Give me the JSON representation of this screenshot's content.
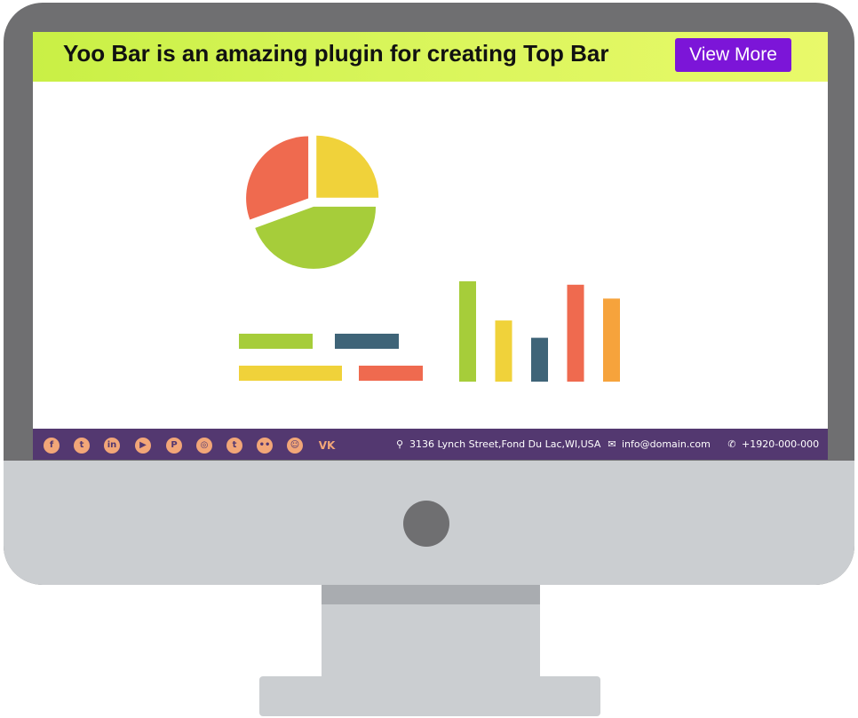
{
  "top_bar": {
    "text": "Yoo Bar is an amazing plugin for creating Top Bar",
    "button_label": "View More",
    "button_color": "#7c15d8",
    "background_color": "#d8f55a"
  },
  "illustration": {
    "pie_colors": [
      "#f0d23a",
      "#a6cd3a",
      "#ef6a4f"
    ],
    "legend_bar_colors": [
      "#a6cd3a",
      "#3f6478",
      "#f0d23a",
      "#ef6a4f"
    ],
    "column_colors": [
      "#a6cd3a",
      "#f0d23a",
      "#3f6478",
      "#ef6a4f",
      "#f6a33c"
    ],
    "column_levels": [
      0.87,
      0.53,
      0.38,
      0.84,
      0.72
    ]
  },
  "bottom_bar": {
    "background_color": "#533870",
    "social_icons": [
      {
        "name": "facebook-icon",
        "glyph": "f"
      },
      {
        "name": "twitter-icon",
        "glyph": "t"
      },
      {
        "name": "linkedin-icon",
        "glyph": "in"
      },
      {
        "name": "youtube-icon",
        "glyph": "▶"
      },
      {
        "name": "pinterest-icon",
        "glyph": "P"
      },
      {
        "name": "instagram-icon",
        "glyph": "◎"
      },
      {
        "name": "tumblr-icon",
        "glyph": "t"
      },
      {
        "name": "flickr-icon",
        "glyph": "••"
      },
      {
        "name": "reddit-icon",
        "glyph": "☺"
      },
      {
        "name": "vk-icon",
        "glyph": "VK"
      }
    ],
    "address": "3136 Lynch Street,Fond Du Lac,WI,USA",
    "email": "info@domain.com",
    "phone": "+1920-000-000"
  }
}
